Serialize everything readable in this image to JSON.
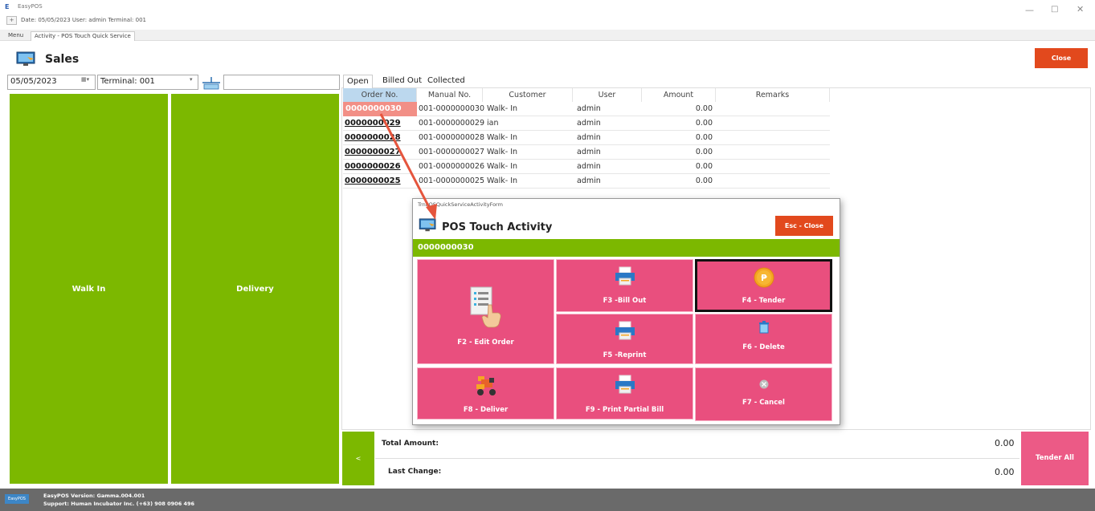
{
  "titlebar": {
    "logo": "E",
    "app_name": "EasyPOS",
    "expand": "+",
    "status": "Date: 05/05/2023   User: admin   Terminal: 001",
    "min": "—",
    "max": "□",
    "close": "✕"
  },
  "doc_tabs": {
    "menu": "Menu",
    "activity": "Activity - POS Touch Quick Service"
  },
  "header": {
    "title": "Sales",
    "close_label": "Close"
  },
  "filters": {
    "date": "05/05/2023",
    "date_icon": "▦▾",
    "terminal": "Terminal: 001",
    "terminal_caret": "▾",
    "search_value": ""
  },
  "big_buttons": {
    "walkin": "Walk In",
    "delivery": "Delivery"
  },
  "list_tabs": [
    "Open",
    "Billed Out",
    "Collected"
  ],
  "table": {
    "headers": [
      "Order No.",
      "Manual No.",
      "Customer",
      "User",
      "Amount",
      "Remarks"
    ],
    "rows": [
      {
        "order": "0000000030",
        "manual": "001-0000000030 Walk- In",
        "user": "admin",
        "amount": "0.00"
      },
      {
        "order": "0000000029",
        "manual": "001-0000000029 ian",
        "user": "admin",
        "amount": "0.00"
      },
      {
        "order": "0000000028",
        "manual": "001-0000000028 Walk- In",
        "user": "admin",
        "amount": "0.00"
      },
      {
        "order": "0000000027",
        "manual": "001-0000000027 Walk- In",
        "user": "admin",
        "amount": "0.00"
      },
      {
        "order": "0000000026",
        "manual": "001-0000000026 Walk- In",
        "user": "admin",
        "amount": "0.00"
      },
      {
        "order": "0000000025",
        "manual": "001-0000000025 Walk- In",
        "user": "admin",
        "amount": "0.00"
      }
    ]
  },
  "totals": {
    "collapse": "<",
    "total_label": "Total Amount:",
    "total_value": "0.00",
    "change_label": "Last Change:",
    "change_value": "0.00",
    "tender_all": "Tender All"
  },
  "footer": {
    "logo": "EasyPOS",
    "version": "EasyPOS Version: Gamma.004.001",
    "support": "Support: Human Incubator Inc. (+63) 908 0906 496"
  },
  "popup": {
    "form_name": "TrnPOSQuickServiceActivityForm",
    "title": "POS Touch Activity",
    "esc_close": "Esc - Close",
    "order_no": "0000000030",
    "buttons": {
      "edit": "F2 - Edit Order",
      "billout": "F3 -Bill Out",
      "tender": "F4 - Tender",
      "reprint": "F5 -Reprint",
      "delete": "F6 - Delete",
      "cancel": "F7 - Cancel",
      "deliver": "F8 - Deliver",
      "partial": "F9 - Print Partial Bill"
    }
  },
  "colors": {
    "green": "#7cb800",
    "pink": "#e94f7e",
    "orange": "#e2491d",
    "selected_row": "#f28f86"
  },
  "icons": [
    "monitor-icon",
    "calendar-icon",
    "keyboard-icon",
    "document-hand-icon",
    "printer-icon",
    "coin-icon",
    "trash-icon",
    "cancel-icon",
    "delivery-icon"
  ]
}
